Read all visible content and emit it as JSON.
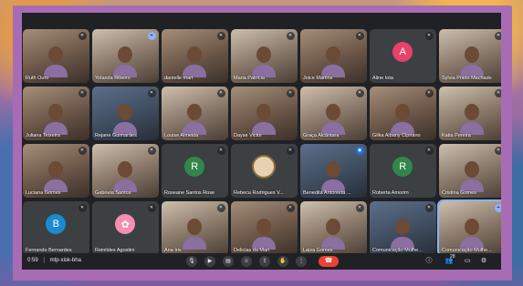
{
  "meeting": {
    "time": "0:59",
    "code": "mtp-xisk-bha"
  },
  "participants": [
    {
      "name": "Ruth Ouro",
      "kind": "video",
      "tone": "v2",
      "state": "mic-off"
    },
    {
      "name": "Yolanda Ribeiro",
      "kind": "video",
      "tone": "v3",
      "state": "pin"
    },
    {
      "name": "danielle mart",
      "kind": "video",
      "tone": "v2",
      "state": "mic-off"
    },
    {
      "name": "Maria Patrícia",
      "kind": "video",
      "tone": "v3",
      "state": "mic-off"
    },
    {
      "name": "Joice Martins",
      "kind": "video",
      "tone": "v2",
      "state": "mic-off"
    },
    {
      "name": "Aline Iota",
      "kind": "avatar",
      "letter": "A",
      "color": "#e8416b",
      "state": "mic-off"
    },
    {
      "name": "Sylvia Prieto Machado",
      "kind": "video",
      "tone": "v3",
      "state": "mic-off"
    },
    {
      "name": "Juliana Teixeira",
      "kind": "video",
      "tone": "v2",
      "state": "mic-off"
    },
    {
      "name": "Rejane Guimarães",
      "kind": "video",
      "tone": "v4",
      "state": "mic-off"
    },
    {
      "name": "Louise Almeida",
      "kind": "video",
      "tone": "v3",
      "state": "mic-off"
    },
    {
      "name": "Dayse Victor",
      "kind": "video",
      "tone": "v2",
      "state": "mic-off"
    },
    {
      "name": "Graça Alcântara",
      "kind": "video",
      "tone": "v3",
      "state": "mic-off"
    },
    {
      "name": "Gilka Albany Cipriano",
      "kind": "video",
      "tone": "v2",
      "state": "mic-off"
    },
    {
      "name": "Katia Pereira",
      "kind": "video",
      "tone": "v3",
      "state": "mic-off"
    },
    {
      "name": "Luciana Gomes",
      "kind": "video",
      "tone": "v2",
      "state": "mic-off"
    },
    {
      "name": "Gabriela Santos",
      "kind": "video",
      "tone": "v3",
      "state": "mic-off"
    },
    {
      "name": "Roseane Santos Rose",
      "kind": "avatar",
      "letter": "R",
      "color": "#33864a",
      "state": "mic-off"
    },
    {
      "name": "Rebeca Rodrigues V...",
      "kind": "badge",
      "state": "mic-off"
    },
    {
      "name": "Benedita Antonieta ...",
      "kind": "video",
      "tone": "v4",
      "state": "speaking"
    },
    {
      "name": "Roberta Amorim",
      "kind": "avatar",
      "letter": "R",
      "color": "#33864a",
      "state": "mic-off"
    },
    {
      "name": "Cristina Gomes",
      "kind": "video",
      "tone": "v3",
      "state": "mic-off"
    },
    {
      "name": "Fernando Bernardes",
      "kind": "avatar",
      "letter": "B",
      "color": "#1a8ad1",
      "state": "mic-off"
    },
    {
      "name": "Reinildes Agostini",
      "kind": "logo",
      "state": "mic-off"
    },
    {
      "name": "Ana Iris",
      "kind": "video",
      "tone": "v3",
      "state": "mic-off"
    },
    {
      "name": "Delicias da Mari",
      "kind": "video",
      "tone": "v2",
      "state": "mic-off"
    },
    {
      "name": "Laiza Gomes",
      "kind": "video",
      "tone": "v3",
      "state": "mic-off"
    },
    {
      "name": "Comunicação Mulhe...",
      "kind": "video",
      "tone": "v4",
      "state": "mic-off"
    },
    {
      "name": "Comunicação Mulhe...",
      "kind": "video",
      "tone": "v3",
      "state": "pin",
      "active": true
    }
  ],
  "participant_count": "28",
  "icons": {
    "mic": "mic-off-icon",
    "speaking": "speaking-icon",
    "pin": "pin-icon"
  }
}
